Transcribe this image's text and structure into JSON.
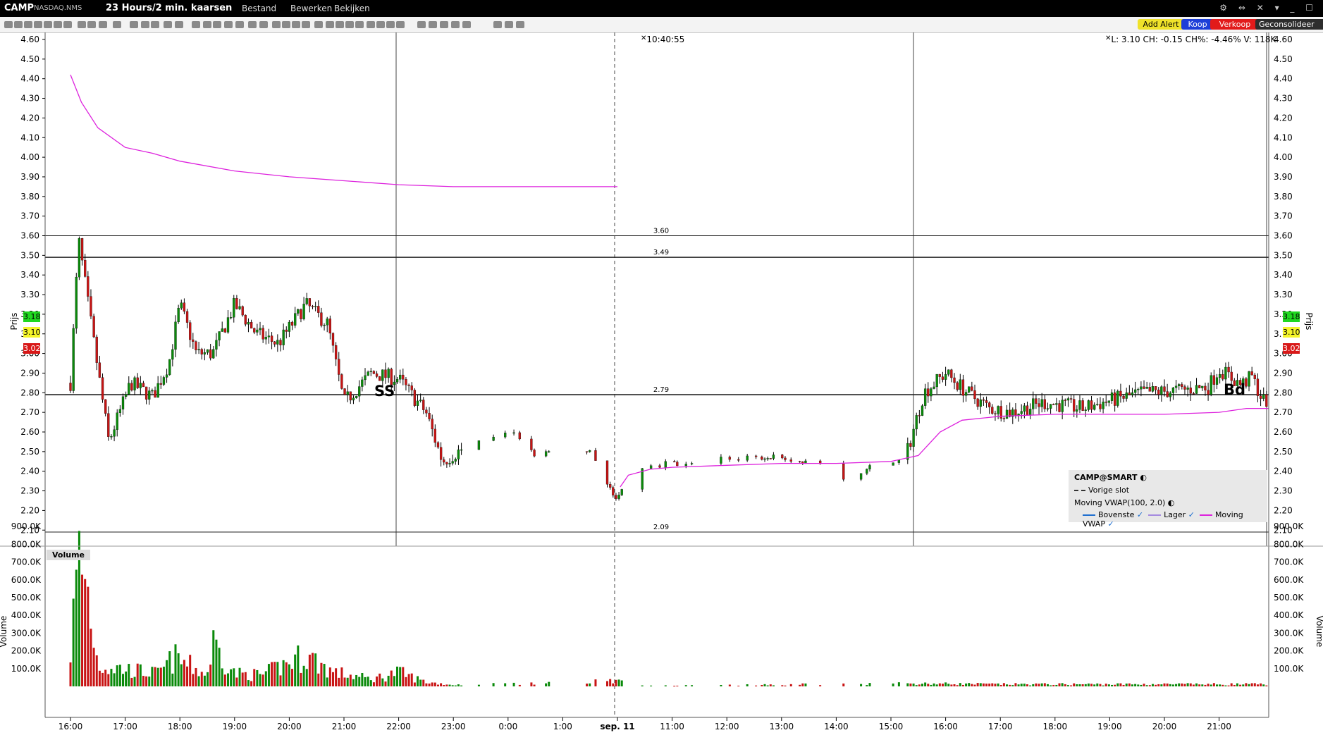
{
  "header": {
    "symbol": "CAMP",
    "exchange": "NASDAQ.NMS",
    "period": "23 Hours/2 min. kaarsen",
    "menus": [
      "Bestand",
      "Bewerken",
      "Bekijken"
    ]
  },
  "toolbar": {
    "add_alert": "Add Alert",
    "buy": "Koop",
    "sell": "Verkoop",
    "consolidated": "Geconsolideer"
  },
  "readout": {
    "time": "10:40:55",
    "quote": "L: 3.10 CH: -0.15 CH%: -4.46% V: 118K"
  },
  "colors": {
    "up": "#0a8a0a",
    "down": "#c81414",
    "vwap": "#dd22dd",
    "tag_green": "#1fd81f",
    "tag_yellow": "#f5f52a",
    "tag_red": "#d81818"
  },
  "legend": {
    "title": "CAMP@SMART",
    "prev_close": "Vorige slot",
    "indicator": "Moving VWAP(100, 2.0)",
    "upper": "Bovenste",
    "lower": "Lager",
    "vwap": "Moving VWAP"
  },
  "markers": {
    "left": "SS",
    "right": "Bd"
  },
  "price_tags": [
    "3.18",
    "3.10",
    "3.02"
  ],
  "volume_badge": "Volume",
  "chart_data": {
    "type": "candlestick",
    "price_axis": {
      "label": "Prijs",
      "ticks": [
        "4.60",
        "4.50",
        "4.40",
        "4.30",
        "4.20",
        "4.10",
        "4.00",
        "3.90",
        "3.80",
        "3.70",
        "3.60",
        "3.50",
        "3.40",
        "3.30",
        "3.20",
        "3.10",
        "3.00",
        "2.90",
        "2.80",
        "2.70",
        "2.60",
        "2.50",
        "2.40",
        "2.30",
        "2.20",
        "2.10"
      ],
      "ylim": [
        2.07,
        4.63
      ]
    },
    "volume_axis": {
      "label": "Volume",
      "ticks": [
        "900.0K",
        "800.0K",
        "700.0K",
        "600.0K",
        "500.0K",
        "400.0K",
        "300.0K",
        "200.0K",
        "100.0K"
      ],
      "ylim": [
        0,
        950000
      ]
    },
    "x_axis": {
      "ticks": [
        "16:00",
        "17:00",
        "18:00",
        "19:00",
        "20:00",
        "21:00",
        "22:00",
        "23:00",
        "0:00",
        "1:00",
        "sep. 11",
        "11:00",
        "12:00",
        "13:00",
        "14:00",
        "15:00",
        "16:00",
        "17:00",
        "18:00",
        "19:00",
        "20:00",
        "21:00"
      ]
    },
    "levels": [
      {
        "label": "3.60",
        "value": 3.6
      },
      {
        "label": "3.49",
        "value": 3.49
      },
      {
        "label": "2.79",
        "value": 2.79
      },
      {
        "label": "2.09",
        "value": 2.09
      }
    ],
    "price_path": [
      {
        "x": 0.0,
        "y": 2.85
      },
      {
        "x": 0.15,
        "y": 3.58
      },
      {
        "x": 0.35,
        "y": 3.2
      },
      {
        "x": 0.7,
        "y": 2.55
      },
      {
        "x": 1.1,
        "y": 2.85
      },
      {
        "x": 1.5,
        "y": 2.78
      },
      {
        "x": 1.8,
        "y": 2.95
      },
      {
        "x": 2.0,
        "y": 3.25
      },
      {
        "x": 2.3,
        "y": 3.0
      },
      {
        "x": 2.6,
        "y": 3.0
      },
      {
        "x": 3.0,
        "y": 3.25
      },
      {
        "x": 3.4,
        "y": 3.1
      },
      {
        "x": 3.8,
        "y": 3.05
      },
      {
        "x": 4.3,
        "y": 3.25
      },
      {
        "x": 4.7,
        "y": 3.15
      },
      {
        "x": 5.0,
        "y": 2.75
      },
      {
        "x": 5.5,
        "y": 2.9
      },
      {
        "x": 6.0,
        "y": 2.87
      },
      {
        "x": 6.5,
        "y": 2.7
      },
      {
        "x": 6.8,
        "y": 2.45
      },
      {
        "x": 7.2,
        "y": 2.52
      },
      {
        "x": 7.6,
        "y": 2.55
      },
      {
        "x": 8.0,
        "y": 2.62
      },
      {
        "x": 8.5,
        "y": 2.48
      },
      {
        "x": 9.0,
        "y": 2.55
      },
      {
        "x": 9.5,
        "y": 2.5
      },
      {
        "x": 10.0,
        "y": 2.25
      },
      {
        "x": 10.3,
        "y": 2.42
      },
      {
        "x": 11.0,
        "y": 2.44
      },
      {
        "x": 12.0,
        "y": 2.46
      },
      {
        "x": 13.0,
        "y": 2.47
      },
      {
        "x": 14.0,
        "y": 2.43
      },
      {
        "x": 14.2,
        "y": 2.33
      },
      {
        "x": 14.6,
        "y": 2.42
      },
      {
        "x": 15.0,
        "y": 2.45
      },
      {
        "x": 15.3,
        "y": 2.5
      },
      {
        "x": 15.6,
        "y": 2.8
      },
      {
        "x": 16.0,
        "y": 2.9
      },
      {
        "x": 16.4,
        "y": 2.8
      },
      {
        "x": 16.8,
        "y": 2.72
      },
      {
        "x": 17.2,
        "y": 2.7
      },
      {
        "x": 17.8,
        "y": 2.75
      },
      {
        "x": 18.5,
        "y": 2.72
      },
      {
        "x": 19.0,
        "y": 2.76
      },
      {
        "x": 19.6,
        "y": 2.8
      },
      {
        "x": 20.2,
        "y": 2.81
      },
      {
        "x": 20.8,
        "y": 2.83
      },
      {
        "x": 21.0,
        "y": 2.92
      },
      {
        "x": 21.4,
        "y": 2.84
      },
      {
        "x": 21.6,
        "y": 2.88
      },
      {
        "x": 21.8,
        "y": 2.76
      }
    ],
    "vwap_series": {
      "name": "Moving VWAP",
      "segments": [
        [
          {
            "x": 0.0,
            "y": 4.42
          },
          {
            "x": 0.2,
            "y": 4.28
          },
          {
            "x": 0.5,
            "y": 4.15
          },
          {
            "x": 1.0,
            "y": 4.05
          },
          {
            "x": 1.5,
            "y": 4.02
          },
          {
            "x": 2.0,
            "y": 3.98
          },
          {
            "x": 3.0,
            "y": 3.93
          },
          {
            "x": 4.0,
            "y": 3.9
          },
          {
            "x": 5.0,
            "y": 3.88
          },
          {
            "x": 6.0,
            "y": 3.86
          },
          {
            "x": 7.0,
            "y": 3.85
          },
          {
            "x": 8.0,
            "y": 3.85
          },
          {
            "x": 9.0,
            "y": 3.85
          },
          {
            "x": 10.0,
            "y": 3.85
          }
        ],
        [
          {
            "x": 10.05,
            "y": 2.32
          },
          {
            "x": 10.2,
            "y": 2.38
          },
          {
            "x": 10.6,
            "y": 2.41
          },
          {
            "x": 11.0,
            "y": 2.42
          },
          {
            "x": 12.0,
            "y": 2.43
          },
          {
            "x": 13.0,
            "y": 2.44
          },
          {
            "x": 14.0,
            "y": 2.44
          },
          {
            "x": 15.0,
            "y": 2.45
          },
          {
            "x": 15.5,
            "y": 2.48
          },
          {
            "x": 15.9,
            "y": 2.6
          },
          {
            "x": 16.3,
            "y": 2.66
          },
          {
            "x": 17.0,
            "y": 2.68
          },
          {
            "x": 18.0,
            "y": 2.69
          },
          {
            "x": 19.0,
            "y": 2.69
          },
          {
            "x": 20.0,
            "y": 2.69
          },
          {
            "x": 21.0,
            "y": 2.7
          },
          {
            "x": 21.5,
            "y": 2.72
          },
          {
            "x": 21.9,
            "y": 2.72
          }
        ]
      ]
    },
    "volume_profile": [
      {
        "x": 0.0,
        "y": 250000
      },
      {
        "x": 0.15,
        "y": 900000
      },
      {
        "x": 0.3,
        "y": 700000
      },
      {
        "x": 0.5,
        "y": 150000
      },
      {
        "x": 1.0,
        "y": 120000
      },
      {
        "x": 1.6,
        "y": 90000
      },
      {
        "x": 1.9,
        "y": 200000
      },
      {
        "x": 2.5,
        "y": 80000
      },
      {
        "x": 2.6,
        "y": 310000
      },
      {
        "x": 3.0,
        "y": 90000
      },
      {
        "x": 3.5,
        "y": 80000
      },
      {
        "x": 4.3,
        "y": 220000
      },
      {
        "x": 4.8,
        "y": 100000
      },
      {
        "x": 5.5,
        "y": 50000
      },
      {
        "x": 6.0,
        "y": 100000
      },
      {
        "x": 6.5,
        "y": 30000
      },
      {
        "x": 7.0,
        "y": 10000
      },
      {
        "x": 10.0,
        "y": 40000
      },
      {
        "x": 10.5,
        "y": 5000
      },
      {
        "x": 15.5,
        "y": 20000
      },
      {
        "x": 17.0,
        "y": 15000
      },
      {
        "x": 21.9,
        "y": 15000
      }
    ]
  }
}
